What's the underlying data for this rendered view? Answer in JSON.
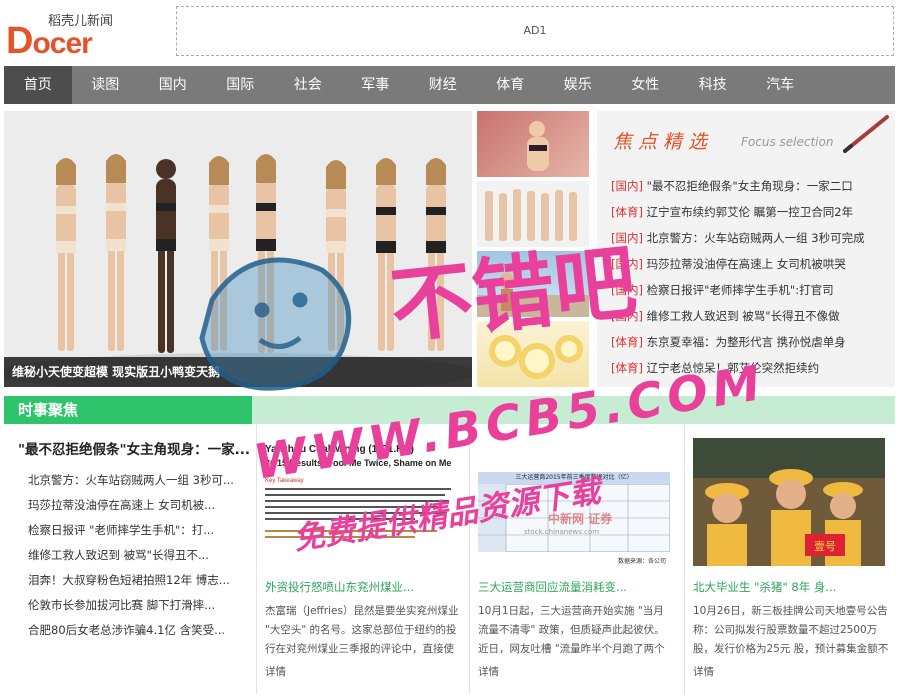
{
  "header": {
    "logo_small": "稻壳儿新闻",
    "logo_main": "ocer",
    "ad_label": "AD1"
  },
  "nav": {
    "items": [
      "首页",
      "读图",
      "国内",
      "国际",
      "社会",
      "军事",
      "财经",
      "体育",
      "娱乐",
      "女性",
      "科技",
      "汽车"
    ],
    "active_index": 0
  },
  "hero": {
    "caption": "维秘小天使变超模 现实版丑小鸭变天鹅"
  },
  "focus": {
    "title": "焦点精选",
    "subtitle": "Focus selection",
    "items": [
      {
        "cat": "[国内]",
        "text": "\"最不忍拒绝假条\"女主角现身：一家二口"
      },
      {
        "cat": "[体育]",
        "text": "辽宁宣布续约郭艾伦 瞩第一控卫合同2年"
      },
      {
        "cat": "[国内]",
        "text": "北京警方：火车站窃贼两人一组 3秒可完成"
      },
      {
        "cat": "[国内]",
        "text": "玛莎拉蒂没油停在高速上 女司机被哄哭"
      },
      {
        "cat": "[国内]",
        "text": "检察日报评\"老师摔学生手机\":打官司"
      },
      {
        "cat": "[国内]",
        "text": "维修工救人致迟到 被骂\"长得丑不像做"
      },
      {
        "cat": "[体育]",
        "text": "东京夏幸福：为整形代言 携孙悦虐单身"
      },
      {
        "cat": "[体育]",
        "text": "辽宁老总惊呆！郭艾伦突然拒续约"
      }
    ]
  },
  "section": {
    "title": "时事聚焦",
    "lead": "\"最不忍拒绝假条\"女主角现身：一家...",
    "list": [
      "北京警方：火车站窃贼两人一组 3秒可...",
      "玛莎拉蒂没油停在高速上 女司机被...",
      "检察日报评 \"老师摔学生手机\"：打...",
      "维修工救人致迟到 被骂\"长得丑不...",
      "泪奔！大叔穿粉色短裙拍照12年 博志...",
      "伦敦市长参加拔河比赛 脚下打滑摔...",
      "合肥80后女老总涉诈骗4.1亿 含笑受..."
    ]
  },
  "cards": [
    {
      "title": "外资投行怒喷山东兖州煤业...",
      "body": "杰富瑞（Jeffries）昆然是要坐实兖州煤业 \"大空头\" 的名号。这家总部位于纽约的投行在对兖州煤业三季报的评论中，直接使",
      "more": "详情",
      "img_heading_1": "Yanzhou Coal Mining (1171.HK)",
      "img_heading_2": "3Q15 Results: Fool Me Twice, Shame on Me",
      "img_keytag": "Key Takeaway"
    },
    {
      "title": "三大运营商回应流量消耗变...",
      "body": "10月1日起，三大运营商开始实施 \"当月流量不清零\" 政策，但质疑声此起彼伏。近日，网友吐槽 \"流量昨半个月跑了两个",
      "more": "详情",
      "img_table_title": "三大运营商2015年前三季度数据对比（亿）",
      "img_footer": "数据来源：各公司",
      "img_watermark": "中新网 证券",
      "img_watermark_url": "stock.chinanews.com"
    },
    {
      "title": "北大毕业生 \"杀猪\" 8年 身...",
      "body": "10月26日，新三板挂牌公司天地壹号公告称：公司拟发行股票数量不超过2500万股，发行价格为25元 股，预计募集金额不超过 6",
      "more": "详情",
      "img_sign": "壹号"
    }
  ],
  "watermark": {
    "line1": "不错吧",
    "line2": "WWW.BCB5.COM",
    "line3": "免费提供精品资源下载"
  },
  "colors": {
    "accent": "#e4532a",
    "nav_bg": "#7a7a7a",
    "nav_active": "#4d4d4d",
    "section_green": "#2ec46b",
    "section_light": "#c7ecd4",
    "card_title": "#2ea55a",
    "watermark": "#e8409b"
  }
}
